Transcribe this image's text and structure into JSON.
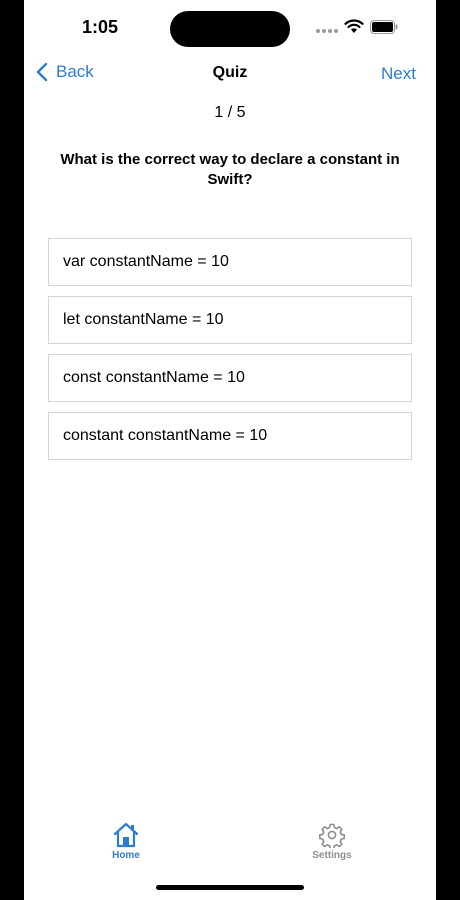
{
  "status_bar": {
    "time": "1:05"
  },
  "nav": {
    "back_label": "Back",
    "title": "Quiz",
    "next_label": "Next"
  },
  "quiz": {
    "progress": "1 / 5",
    "question": "What is the correct way to declare a constant in Swift?",
    "options": [
      "var constantName = 10",
      "let constantName = 10",
      "const constantName = 10",
      "constant constantName = 10"
    ]
  },
  "tab_bar": {
    "tabs": [
      {
        "label": "Home",
        "icon": "house-icon",
        "selected": true
      },
      {
        "label": "Settings",
        "icon": "gear-icon",
        "selected": false
      }
    ]
  },
  "colors": {
    "accent": "#2f7bd3",
    "inactive": "#8e8e93",
    "border": "#d4d4d4"
  }
}
